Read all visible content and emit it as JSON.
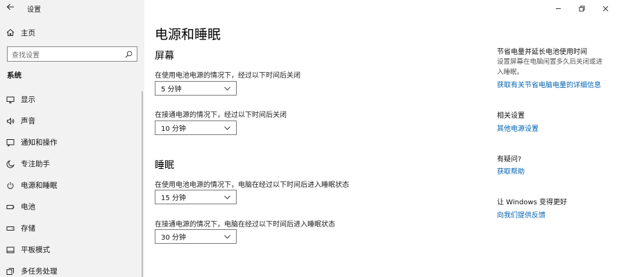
{
  "window": {
    "app_title": "设置"
  },
  "sidebar": {
    "home_label": "主页",
    "search_placeholder": "查找设置",
    "section_label": "系统",
    "items": [
      {
        "label": "显示",
        "icon": "monitor-icon"
      },
      {
        "label": "声音",
        "icon": "speaker-icon"
      },
      {
        "label": "通知和操作",
        "icon": "notification-icon"
      },
      {
        "label": "专注助手",
        "icon": "moon-icon"
      },
      {
        "label": "电源和睡眠",
        "icon": "power-icon",
        "active": true
      },
      {
        "label": "电池",
        "icon": "battery-icon"
      },
      {
        "label": "存储",
        "icon": "storage-icon"
      },
      {
        "label": "平板模式",
        "icon": "tablet-icon"
      },
      {
        "label": "多任务处理",
        "icon": "multitask-icon"
      }
    ]
  },
  "main": {
    "title": "电源和睡眠",
    "screen": {
      "heading": "屏幕",
      "battery_label": "在使用电池电源的情况下，经过以下时间后关闭",
      "battery_value": "5 分钟",
      "plugged_label": "在接通电源的情况下，经过以下时间后关闭",
      "plugged_value": "10 分钟"
    },
    "sleep": {
      "heading": "睡眠",
      "battery_label": "在使用电池电源的情况下，电脑在经过以下时间后进入睡眠状态",
      "battery_value": "15 分钟",
      "plugged_label": "在接通电源的情况下，电脑在经过以下时间后进入睡眠状态",
      "plugged_value": "30 分钟"
    }
  },
  "right": {
    "save_heading": "节省电量并延长电池使用时间",
    "save_text": "设置屏幕在电脑闲置多久后关闭或进入睡眠。",
    "save_link": "获取有关节省电脑电量的详细信息",
    "related_heading": "相关设置",
    "related_link": "其他电源设置",
    "question_heading": "有疑问?",
    "question_link": "获取帮助",
    "feedback_heading": "让 Windows 变得更好",
    "feedback_link": "向我们提供反馈"
  },
  "colors": {
    "sidebar_bg": "#f2f2f2",
    "link": "#0063b1"
  }
}
